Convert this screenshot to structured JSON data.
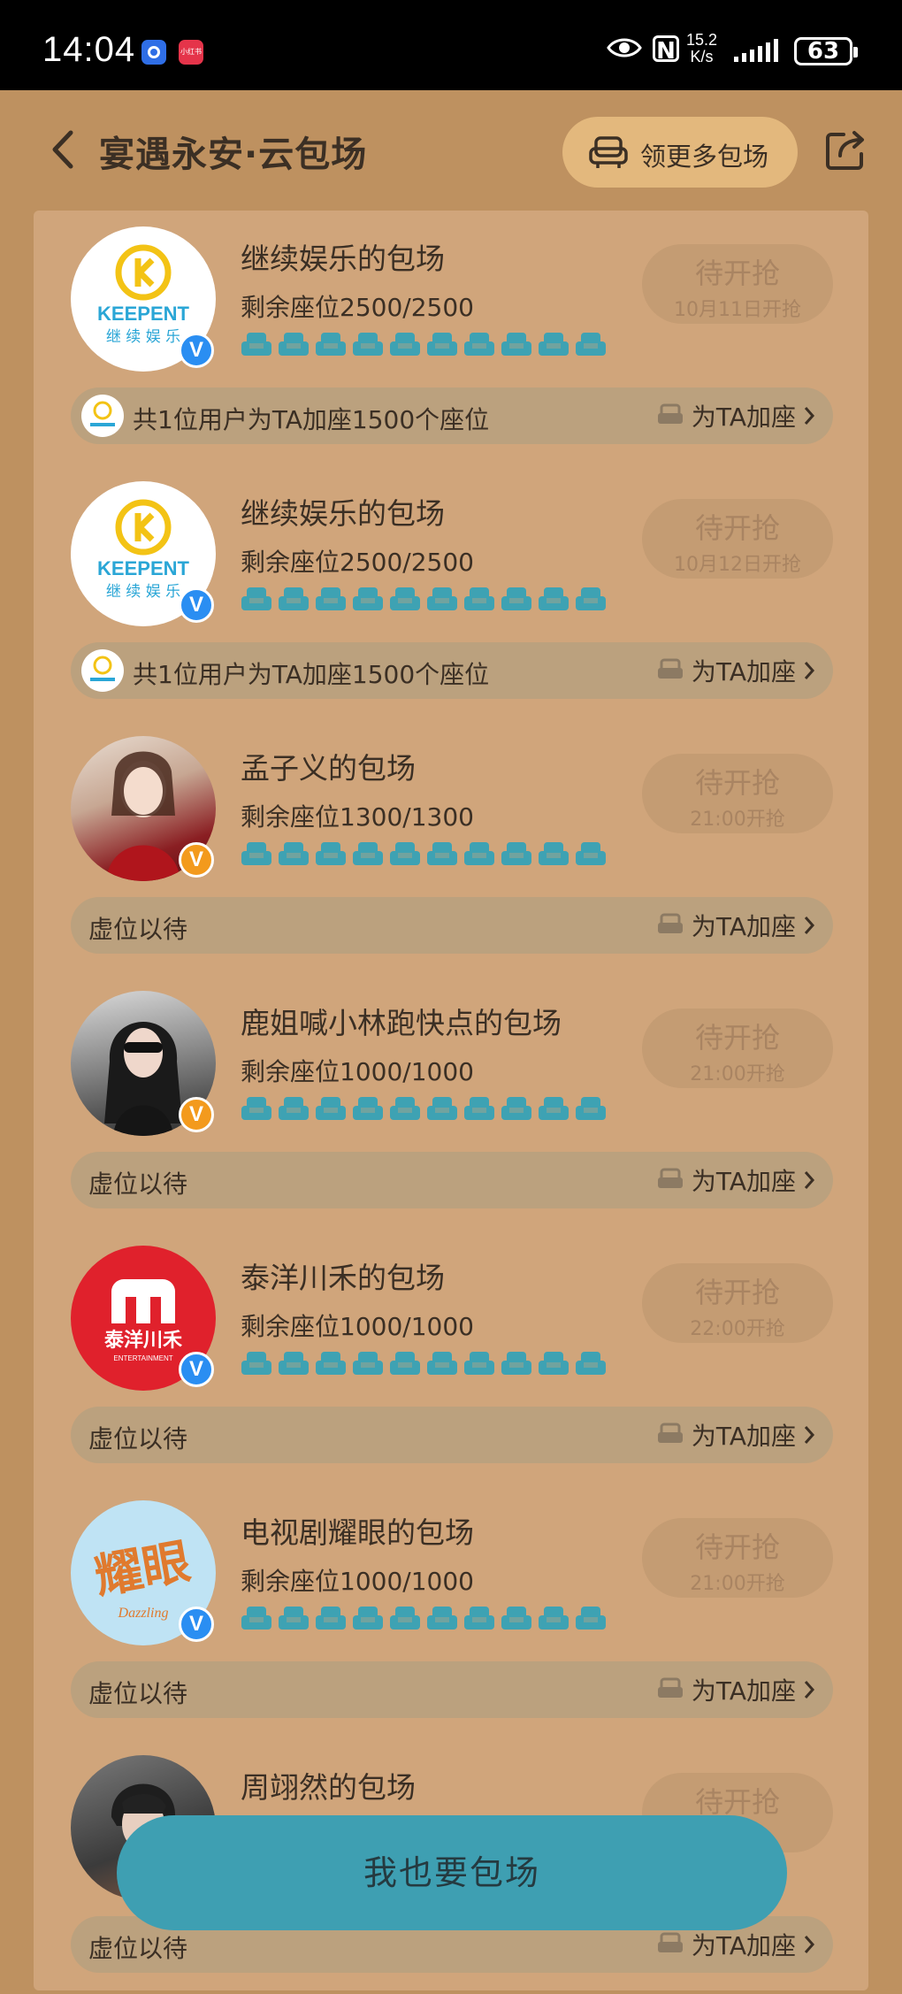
{
  "status_bar": {
    "time": "14:04",
    "net_speed_value": "15.2",
    "net_speed_unit": "K/s",
    "battery": "63",
    "icons": [
      "baidu-app-icon",
      "xiaohongshu-app-icon",
      "eye-icon",
      "nfc-icon",
      "signal-icon",
      "battery-icon"
    ],
    "app2_label": "小红书"
  },
  "header": {
    "title": "宴遇永安·云包场",
    "more_label": "领更多包场",
    "icons": [
      "back-icon",
      "sofa-icon",
      "share-icon"
    ]
  },
  "colors": {
    "background": "#be9160",
    "panel": "#d0a57b",
    "seat": "#3ea2b3",
    "pill": "#c49c73",
    "bar": "#bba17e",
    "fab": "#3e9fb2",
    "verified_blue": "#2a8ef2",
    "verified_orange": "#f39a1d"
  },
  "cards": [
    {
      "name": "继续娱乐的包场",
      "seats": "剩余座位2500/2500",
      "status": "待开抢",
      "status_sub": "10月11日开抢",
      "bar_text": "共1位用户为TA加座1500个座位",
      "bar_action": "为TA加座",
      "avatar_text_top": "KEEPENT",
      "avatar_text_bottom": "继 续 娱 乐",
      "badge": "V"
    },
    {
      "name": "继续娱乐的包场",
      "seats": "剩余座位2500/2500",
      "status": "待开抢",
      "status_sub": "10月12日开抢",
      "bar_text": "共1位用户为TA加座1500个座位",
      "bar_action": "为TA加座",
      "avatar_text_top": "KEEPENT",
      "avatar_text_bottom": "继 续 娱 乐",
      "badge": "V"
    },
    {
      "name": "孟子义的包场",
      "seats": "剩余座位1300/1300",
      "status": "待开抢",
      "status_sub": "21:00开抢",
      "bar_text": "虚位以待",
      "bar_action": "为TA加座",
      "badge": "V"
    },
    {
      "name": "鹿姐喊小林跑快点的包场",
      "seats": "剩余座位1000/1000",
      "status": "待开抢",
      "status_sub": "21:00开抢",
      "bar_text": "虚位以待",
      "bar_action": "为TA加座",
      "badge": "V"
    },
    {
      "name": "泰洋川禾的包场",
      "seats": "剩余座位1000/1000",
      "status": "待开抢",
      "status_sub": "22:00开抢",
      "bar_text": "虚位以待",
      "bar_action": "为TA加座",
      "avatar_text": "泰洋川禾",
      "avatar_subtext": "ENTERTAINMENT",
      "badge": "V"
    },
    {
      "name": "电视剧耀眼的包场",
      "seats": "剩余座位1000/1000",
      "status": "待开抢",
      "status_sub": "21:00开抢",
      "bar_text": "虚位以待",
      "bar_action": "为TA加座",
      "avatar_text": "耀眼",
      "avatar_subtext": "Dazzling",
      "badge": "V"
    },
    {
      "name": "周翊然的包场",
      "seats": "",
      "status": "待开抢",
      "status_sub": "",
      "bar_text": "虚位以待",
      "bar_action": "为TA加座",
      "badge": ""
    }
  ],
  "fab_label": "我也要包场"
}
